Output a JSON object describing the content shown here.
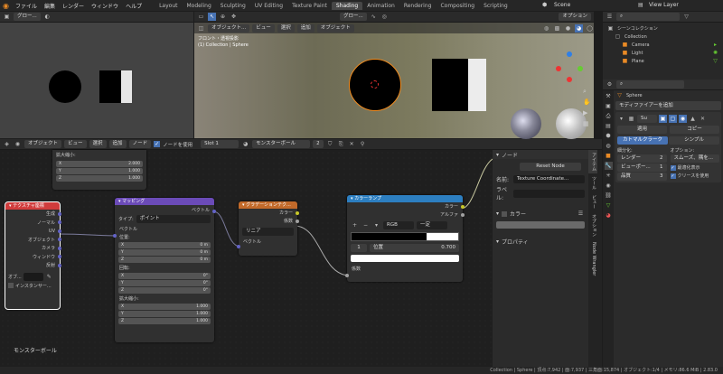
{
  "topbar": {
    "menus": [
      "ファイル",
      "編集",
      "レンダー",
      "ウィンドウ",
      "ヘルプ"
    ],
    "tabs": [
      "Layout",
      "Modeling",
      "Sculpting",
      "UV Editing",
      "Texture Paint",
      "Shading",
      "Animation",
      "Rendering",
      "Compositing",
      "Scripting"
    ],
    "active_tab": "Shading",
    "scene": "Scene",
    "view_layer": "View Layer"
  },
  "left_view": {
    "mode": "グロー..."
  },
  "viewport": {
    "mode": "オブジェクト...",
    "menus": [
      "ビュー",
      "選択",
      "追加",
      "オブジェクト"
    ],
    "mode2": "グロー...",
    "options": "オプション",
    "overlay_title": "フロント・透視投影",
    "overlay_sub": "(1) Collection | Sphere"
  },
  "outliner": {
    "title": "シーンコレクション",
    "items": [
      "Collection",
      "Camera",
      "Light",
      "Plane"
    ]
  },
  "properties": {
    "object": "Sphere",
    "add_modifier": "モディファイアーを追加",
    "mod_name": "Su",
    "apply": "適用",
    "copy": "コピー",
    "catmull": "カトマルクラーク",
    "simple": "シンプル",
    "subdiv_label": "細分化:",
    "options_label": "オプション:",
    "render_label": "レンダー",
    "render_val": "2",
    "viewport_label": "ビューポー...",
    "viewport_val": "1",
    "quality_label": "品質",
    "quality_val": "3",
    "smooth": "スムーズ、隅を...",
    "optimal": "最適化表示",
    "crease": "クリースを使用"
  },
  "node_editor": {
    "mode": "オブジェクト",
    "menus": [
      "ビュー",
      "選択",
      "追加",
      "ノード"
    ],
    "use_nodes": "ノードを使用",
    "slot": "Slot 1",
    "material": "モンスターボール",
    "users": "2",
    "footer_label": "モンスターボール"
  },
  "node_top": {
    "title": "拡大縮小:",
    "x": "2.000",
    "y": "1.000",
    "z": "1.000",
    "lx": "X",
    "ly": "Y",
    "lz": "Z"
  },
  "texcoord": {
    "title": "テクスチャ座標",
    "outputs": [
      "生成",
      "ノーマル",
      "UV",
      "オブジェクト",
      "カメラ",
      "ウィンドウ",
      "反射"
    ],
    "obj_label": "オブ...",
    "instancer": "インスタンサー..."
  },
  "mapping": {
    "title": "マッピング",
    "vector_out": "ベクトル",
    "type_label": "タイプ:",
    "type_val": "ポイント",
    "vector_in": "ベクトル",
    "loc_label": "位置:",
    "loc": [
      "0 m",
      "0 m",
      "0 m"
    ],
    "rot_label": "回転:",
    "rot": [
      "0°",
      "0°",
      "0°"
    ],
    "scale_label": "拡大縮小:",
    "scale": [
      "1.000",
      "1.000",
      "1.000"
    ],
    "axes": [
      "X",
      "Y",
      "Z"
    ]
  },
  "gradient": {
    "title": "グラデーションテク...",
    "out_color": "カラー",
    "out_fac": "係数",
    "type": "リニア",
    "vector_in": "ベクトル"
  },
  "colorramp": {
    "title": "カラーランプ",
    "out_color": "カラー",
    "out_alpha": "アルファ",
    "mode": "RGB",
    "interp": "一定",
    "stop_index": "1",
    "pos_label": "位置",
    "pos_val": "0.700",
    "fac_in": "係数"
  },
  "sidebar": {
    "title": "ノード",
    "reset": "Reset Node",
    "name_label": "名前:",
    "name_val": "Texture Coordinate...",
    "label_label": "ラベル:",
    "color": "カラー",
    "properties": "プロパティ",
    "vtabs": [
      "アイテム",
      "ツール",
      "ビュー",
      "オプション",
      "Node Wrangler"
    ]
  },
  "status": {
    "text": "Collection | Sphere | 頂点:7,942 | 面:7,937 | 三角面:15,874 | オブジェクト:1/4 | メモリ:86.6 MiB | 2.83.0"
  },
  "colors": {
    "accent": "#4772b3",
    "orange": "#e98a25",
    "texcoord_header": "#d03c3c",
    "mapping_header": "#6b4bb8",
    "gradient_header": "#c26a2a",
    "ramp_header": "#2d7fc1"
  }
}
